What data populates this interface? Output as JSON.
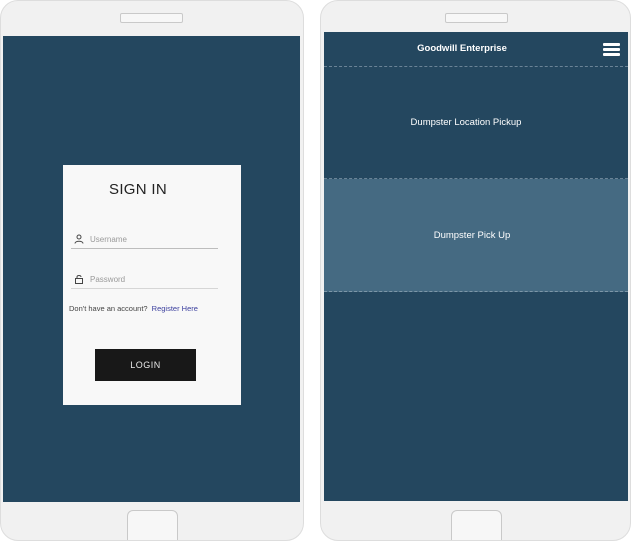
{
  "signin": {
    "title": "SIGN IN",
    "username_placeholder": "Username",
    "password_placeholder": "Password",
    "register_prompt": "Don't have an account?",
    "register_link": "Register Here",
    "login_label": "LOGIN"
  },
  "home": {
    "app_title": "Goodwill Enterprise",
    "menu_items": [
      {
        "label": "Dumpster Location Pickup"
      },
      {
        "label": "Dumpster Pick Up"
      }
    ]
  },
  "colors": {
    "screen_background": "#24475f",
    "selected_item": "#456a82",
    "card_background": "#f8f8f8",
    "login_button": "#181818",
    "link": "#3b3f9e"
  },
  "icons": {
    "username": "user-icon",
    "password": "lock-icon",
    "menu": "hamburger-menu-icon"
  }
}
